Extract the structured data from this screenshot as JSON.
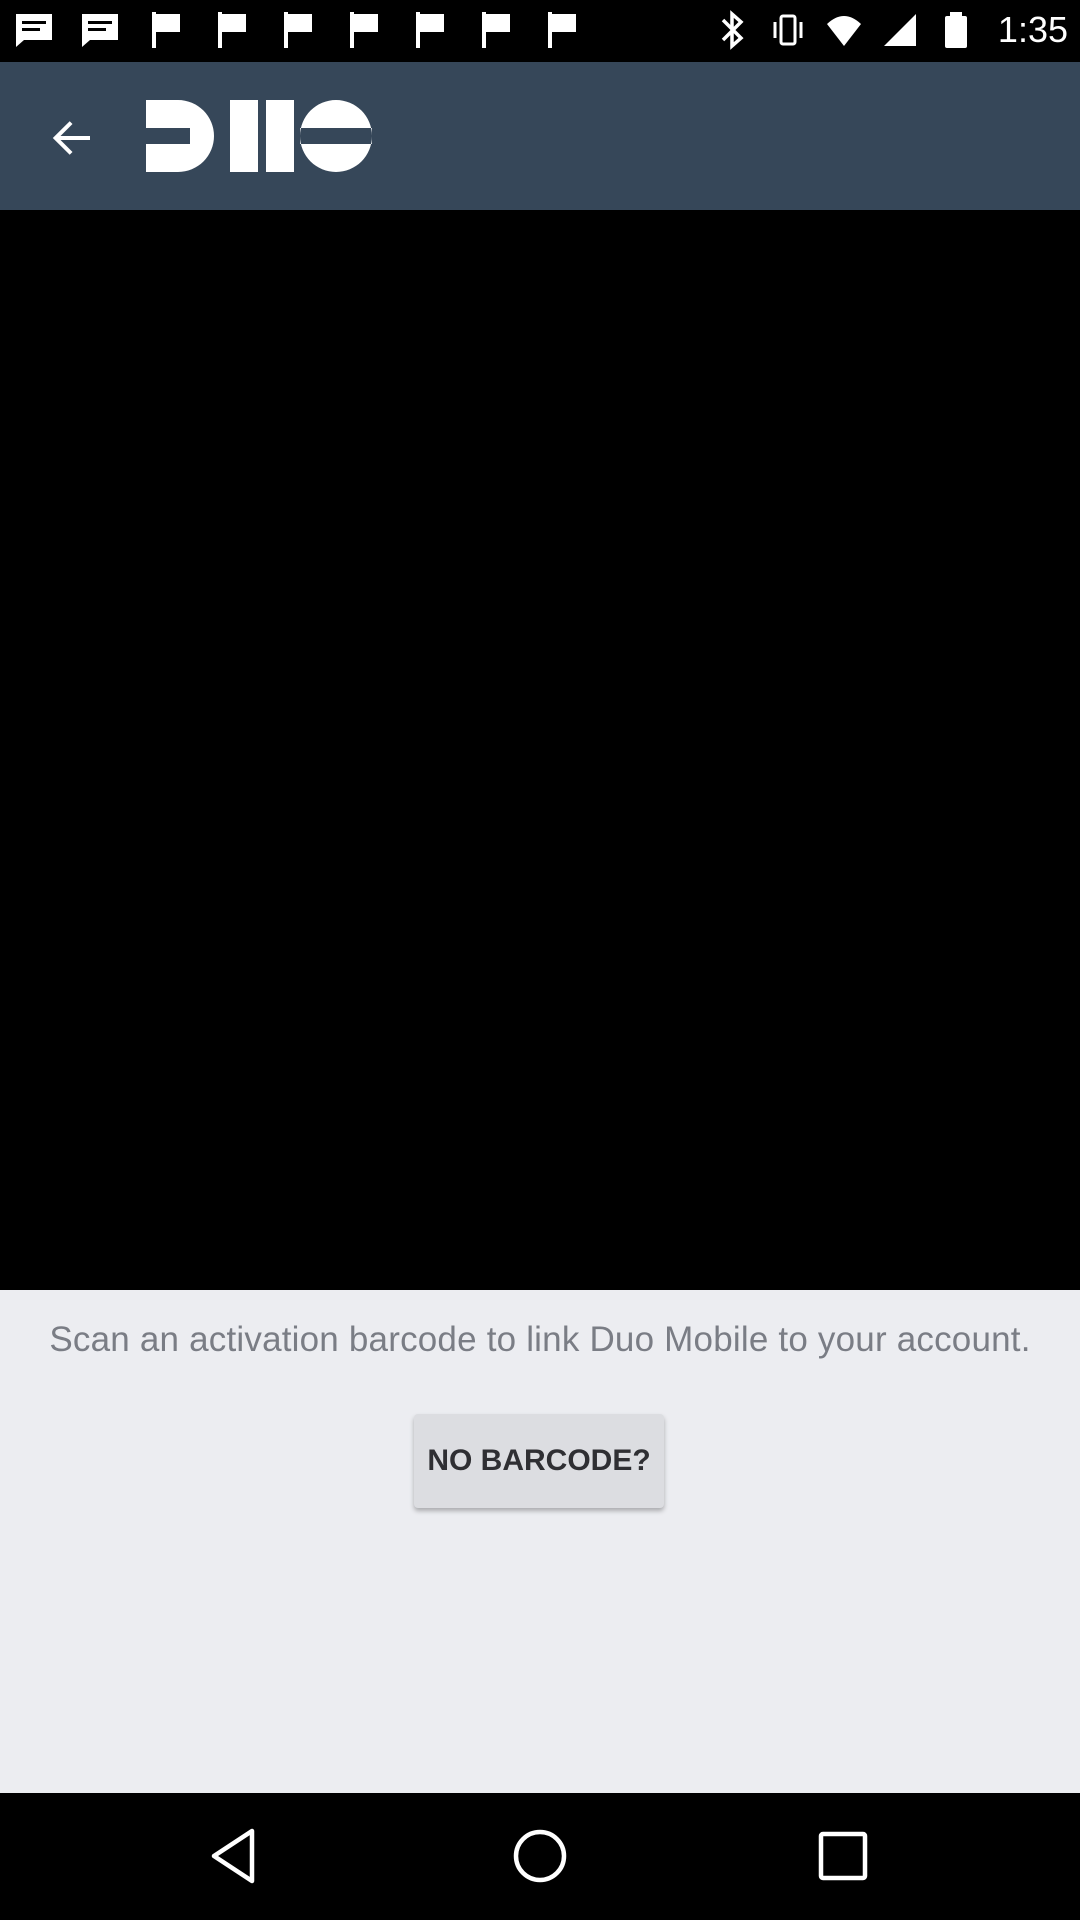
{
  "status_bar": {
    "time": "1:35",
    "notification_icons": [
      "message-icon",
      "message-icon",
      "flag-icon",
      "flag-icon",
      "flag-icon",
      "flag-icon",
      "flag-icon",
      "flag-icon",
      "flag-icon"
    ],
    "system_icons": [
      "bluetooth-icon",
      "vibrate-icon",
      "wifi-icon",
      "signal-icon",
      "battery-icon"
    ]
  },
  "app_bar": {
    "background": "#364759",
    "logo_text": "DUO",
    "back_icon": "arrow-left-icon"
  },
  "scanner": {
    "instruction": "Scan an activation barcode to link Duo Mobile to your account.",
    "no_barcode_label": "NO BARCODE?"
  },
  "nav_bar": {
    "icons": [
      "nav-back-icon",
      "nav-home-icon",
      "nav-recents-icon"
    ]
  }
}
